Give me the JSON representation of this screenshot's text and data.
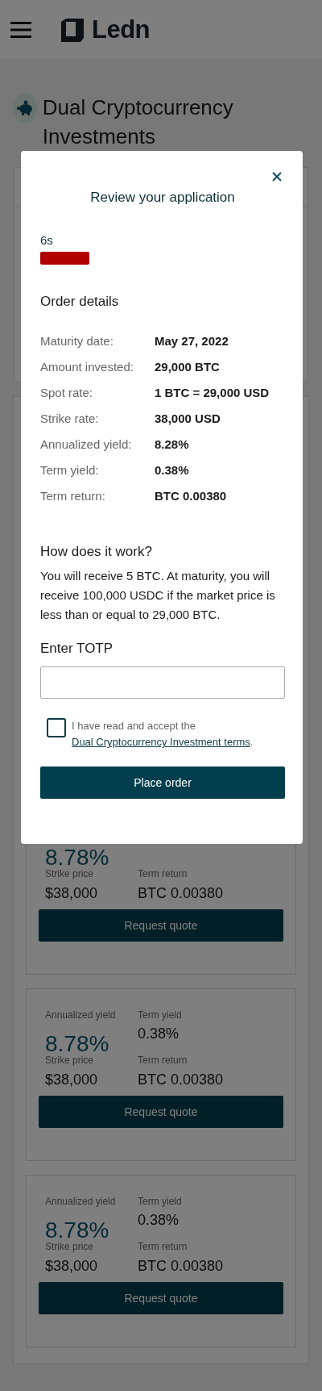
{
  "header": {
    "brand": "Ledn"
  },
  "page": {
    "title": "Dual Cryptocurrency Investments"
  },
  "cards": [
    {
      "annualized_yield": "8.78%",
      "strike_price_label": "Strike price",
      "strike_price": "$38,000",
      "term_return_label": "Term return",
      "term_return": "BTC 0.00380",
      "button": "Request quote"
    },
    {
      "annualized_yield_label": "Annualized yield",
      "annualized_yield": "8.78%",
      "term_yield_label": "Term yield",
      "term_yield": "0.38%",
      "strike_price_label": "Strike price",
      "strike_price": "$38,000",
      "term_return_label": "Term return",
      "term_return": "BTC 0.00380",
      "button": "Request quote"
    },
    {
      "annualized_yield_label": "Annualized yield",
      "annualized_yield": "8.78%",
      "term_yield_label": "Term yield",
      "term_yield": "0.38%",
      "strike_price_label": "Strike price",
      "strike_price": "$38,000",
      "term_return_label": "Term return",
      "term_return": "BTC 0.00380",
      "button": "Request quote"
    }
  ],
  "modal": {
    "title": "Review your application",
    "timer": {
      "text": "6s"
    },
    "order_details_title": "Order details",
    "details": [
      {
        "label": "Maturity date:",
        "value": "May 27, 2022"
      },
      {
        "label": "Amount invested:",
        "value": "29,000 BTC"
      },
      {
        "label": "Spot rate:",
        "value": "1 BTC = 29,000 USD"
      },
      {
        "label": "Strike rate:",
        "value": "38,000 USD"
      },
      {
        "label": "Annualized yield:",
        "value": "8.28%"
      },
      {
        "label": "Term yield:",
        "value": "0.38%"
      },
      {
        "label": "Term return:",
        "value": "BTC 0.00380"
      }
    ],
    "how_title": "How does it work?",
    "how_text": "You will receive 5 BTC. At maturity, you will receive 100,000 USDC if the market price is less than or equal to 29,000 BTC.",
    "totp_label": "Enter TOTP",
    "terms": {
      "checked": false,
      "text": "I have read and accept the",
      "link": "Dual Cryptocurrency Investment terms",
      "after": "."
    },
    "button": "Place order"
  }
}
